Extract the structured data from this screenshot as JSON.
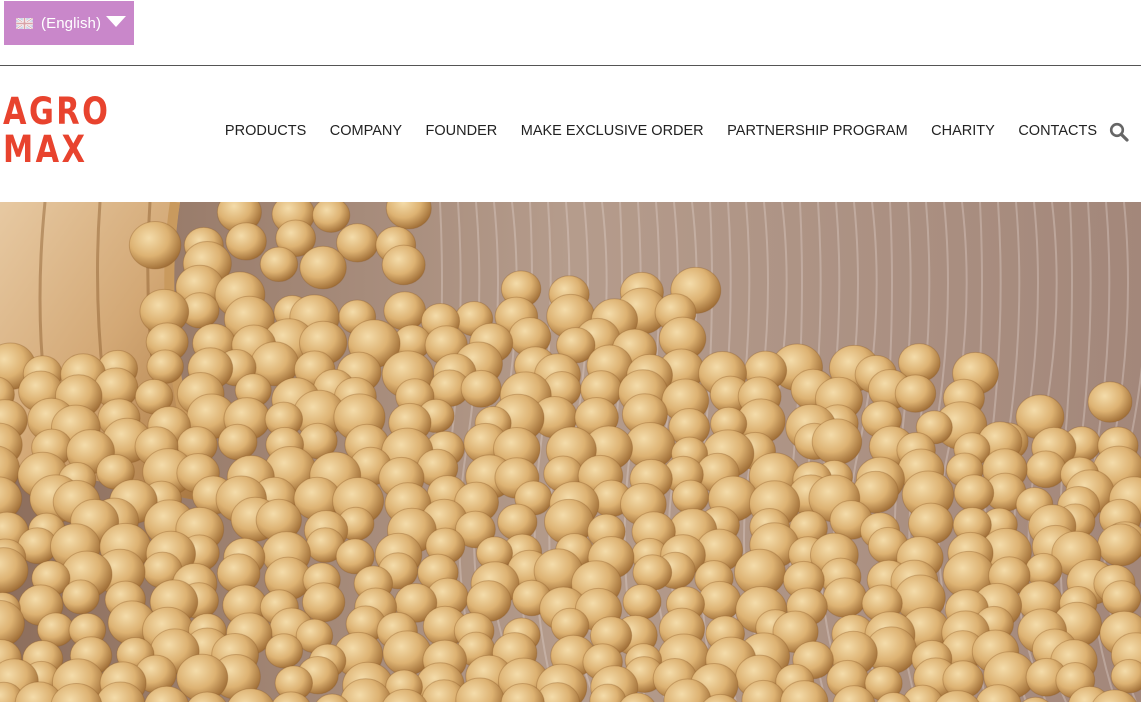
{
  "language": {
    "flag_icon": "uk-flag-icon",
    "selected": "(English)",
    "dropdown_icon": "chevron-down-icon"
  },
  "logo": {
    "line1": "AGRO",
    "line2": "MAX",
    "color": "#e8432e"
  },
  "nav": {
    "items": [
      "PRODUCTS",
      "COMPANY",
      "FOUNDER",
      "MAKE EXCLUSIVE ORDER",
      "PARTNERSHIP PROGRAM",
      "CHARITY",
      "CONTACTS"
    ],
    "search_icon": "search-icon"
  },
  "hero": {
    "image": "soybeans-spilling-from-wooden-scoop"
  },
  "colors": {
    "language_bg": "#c987ca",
    "nav_text": "#222222",
    "accent": "#e8432e"
  }
}
